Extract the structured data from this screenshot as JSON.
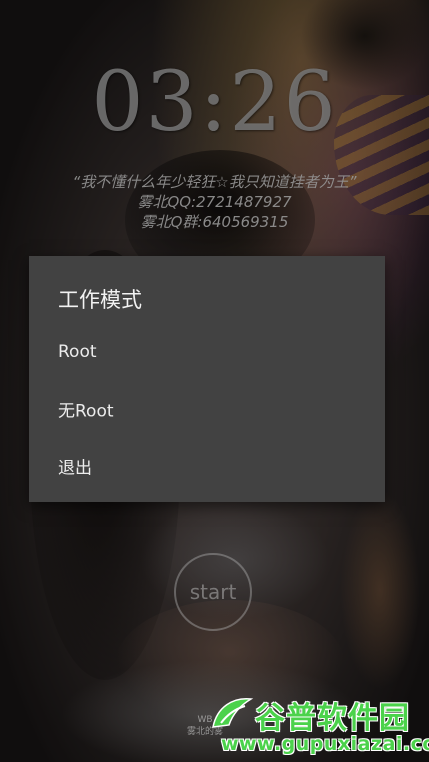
{
  "clock": {
    "time": "03:26"
  },
  "quote": {
    "line1": "“我不懂什么年少轻狂☆我只知道挂者为王”",
    "line2": "雾北QQ:2721487927",
    "line3": "雾北Q群:640569315"
  },
  "dialog": {
    "title": "工作模式",
    "items": [
      {
        "label": "Root"
      },
      {
        "label": "无Root"
      },
      {
        "label": "退出"
      }
    ]
  },
  "start_button": {
    "label": "start"
  },
  "footer": {
    "line1": "WB",
    "line2": "雾北的雾"
  },
  "watermark": {
    "title": "谷普软件园",
    "url": "www.gupuxiazai.com",
    "logo_icon": "gupu-logo-icon",
    "color": "#4bd24b"
  }
}
